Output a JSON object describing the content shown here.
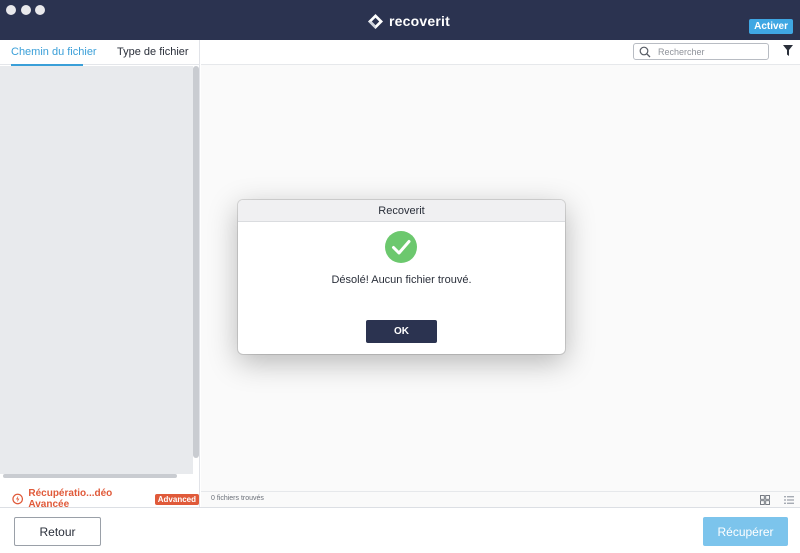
{
  "app": {
    "brand": "recoverit",
    "activate_label": "Activer"
  },
  "sidebar": {
    "tabs": [
      {
        "label": "Chemin du fichier",
        "active": true
      },
      {
        "label": "Type de fichier",
        "active": false
      }
    ],
    "advanced": {
      "label": "Récupératio...déo Avancée",
      "badge": "Advanced"
    }
  },
  "search": {
    "placeholder": "Rechercher"
  },
  "status": {
    "files_found": "0 fichiers trouvés"
  },
  "footer": {
    "back_label": "Retour",
    "recover_label": "Récupérer"
  },
  "dialog": {
    "title": "Recoverit",
    "message": "Désolé! Aucun fichier trouvé.",
    "ok_label": "OK"
  },
  "colors": {
    "titlebar": "#2b3350",
    "accent": "#3a9fd8",
    "success": "#6cc86e",
    "advanced": "#e05a3a"
  }
}
